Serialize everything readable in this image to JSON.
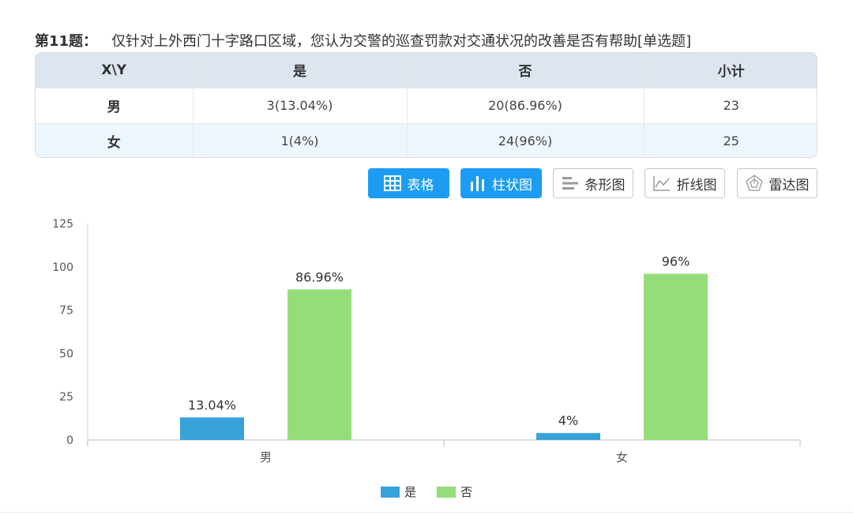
{
  "question": {
    "number": "第11题：",
    "text": "仅针对上外西门十字路口区域，您认为交警的巡查罚款对交通状况的改善是否有帮助[单选题]"
  },
  "table": {
    "headers": [
      "X\\Y",
      "是",
      "否",
      "小计"
    ],
    "rows": [
      {
        "label": "男",
        "cells": [
          "3(13.04%)",
          "20(86.96%)",
          "23"
        ]
      },
      {
        "label": "女",
        "cells": [
          "1(4%)",
          "24(96%)",
          "25"
        ]
      }
    ]
  },
  "toolbar": {
    "buttons": [
      {
        "label": "表格",
        "icon": "table-icon",
        "active": true
      },
      {
        "label": "柱状图",
        "icon": "bar-chart-icon",
        "active": true
      },
      {
        "label": "条形图",
        "icon": "horizontal-bar-icon",
        "active": false
      },
      {
        "label": "折线图",
        "icon": "line-chart-icon",
        "active": false
      },
      {
        "label": "雷达图",
        "icon": "radar-chart-icon",
        "active": false
      }
    ]
  },
  "colors": {
    "accent": "#1c9cf2",
    "series_yes": "#37a2da",
    "series_no": "#95dd7a"
  },
  "chart_data": {
    "type": "bar",
    "categories": [
      "男",
      "女"
    ],
    "series": [
      {
        "name": "是",
        "values": [
          13.04,
          4
        ],
        "labels": [
          "13.04%",
          "4%"
        ],
        "color": "#37a2da"
      },
      {
        "name": "否",
        "values": [
          86.96,
          96
        ],
        "labels": [
          "86.96%",
          "96%"
        ],
        "color": "#95dd7a"
      }
    ],
    "yticks": [
      0,
      25,
      50,
      75,
      100,
      125
    ],
    "ylim": [
      0,
      125
    ],
    "legend": "bottom-center"
  }
}
